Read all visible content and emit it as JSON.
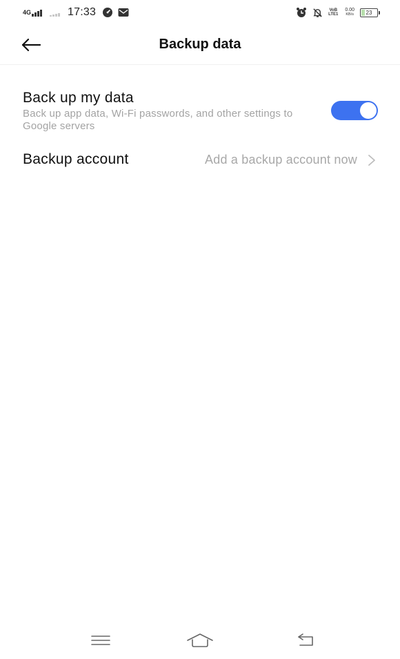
{
  "status_bar": {
    "network": "4G",
    "time": "17:33",
    "volte_top": "VoB",
    "volte_bottom": "LTE1",
    "speed_value": "0.00",
    "speed_unit": "KB/s",
    "battery": "23",
    "battery_level": 0.23
  },
  "header": {
    "title": "Backup data"
  },
  "backup_setting": {
    "title": "Back up my data",
    "subtitle": "Back up app data, Wi-Fi passwords, and other settings to Google servers",
    "enabled": true
  },
  "backup_account": {
    "label": "Backup account",
    "value": "Add a backup account now"
  },
  "colors": {
    "accent": "#3d72f0",
    "secondary_text": "#a3a3a3"
  }
}
